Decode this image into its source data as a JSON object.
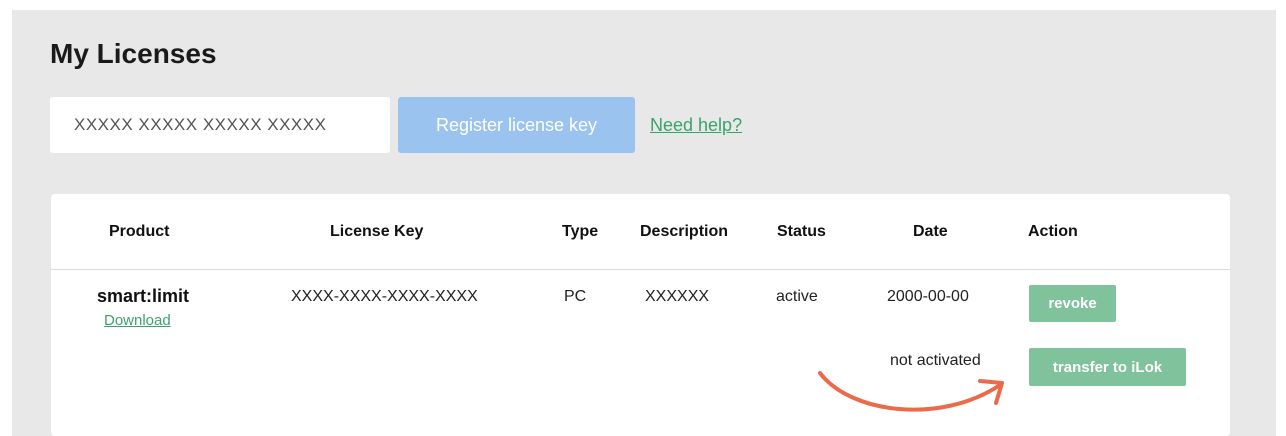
{
  "page": {
    "title": "My Licenses"
  },
  "register": {
    "input_value": "XXXXX XXXXX XXXXX XXXXX",
    "button_label": "Register license key",
    "help_link": "Need help?"
  },
  "table": {
    "columns": [
      "Product",
      "License Key",
      "Type",
      "Description",
      "Status",
      "Date",
      "Action"
    ],
    "rows": [
      {
        "product": "smart:limit",
        "download": "Download",
        "license_key": "XXXX-XXXX-XXXX-XXXX",
        "type": "PC",
        "description": "XXXXXX",
        "status": "active",
        "date": "2000-00-00",
        "action": "revoke",
        "secondary_status": "not activated",
        "secondary_action": "transfer to iLok"
      }
    ]
  },
  "colors": {
    "panel_background": "#e8e8e8",
    "register_button": "#9bc3f0",
    "link_green": "#3aa36c",
    "action_button": "#7fc29b",
    "annotation_arrow": "#ea6a4a"
  },
  "icons": {
    "annotation": "curved-arrow-icon"
  }
}
